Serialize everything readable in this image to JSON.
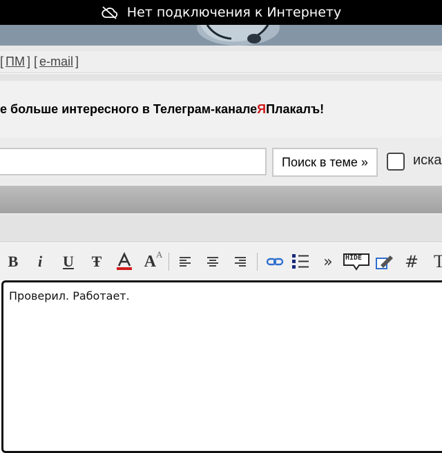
{
  "status_bar": {
    "text": "Нет подключения к Интернету",
    "icon": "cloud-off-icon"
  },
  "links": {
    "pm": "ПМ",
    "email": "e-mail"
  },
  "promo": {
    "prefix": "е больше интересного в Телеграм-канале ",
    "brand_red": "Я",
    "brand_rest": "Плакалъ",
    "suffix": "!"
  },
  "search": {
    "input_value": "",
    "button_label": "Поиск в теме »",
    "checkbox_label": "иска"
  },
  "toolbar": {
    "bold": "B",
    "italic": "i",
    "underline": "U",
    "strike": "Ŧ",
    "font_size": "A",
    "quote": "»",
    "hide": "HIDE",
    "hash": "#",
    "extra": "T"
  },
  "editor": {
    "text": "Проверил. Работает."
  },
  "colors": {
    "status_bar_bg": "#000000",
    "brand_red": "#d11b1b",
    "link_icon": "#2f6fcf",
    "list_icon": "#1a2a7a"
  }
}
